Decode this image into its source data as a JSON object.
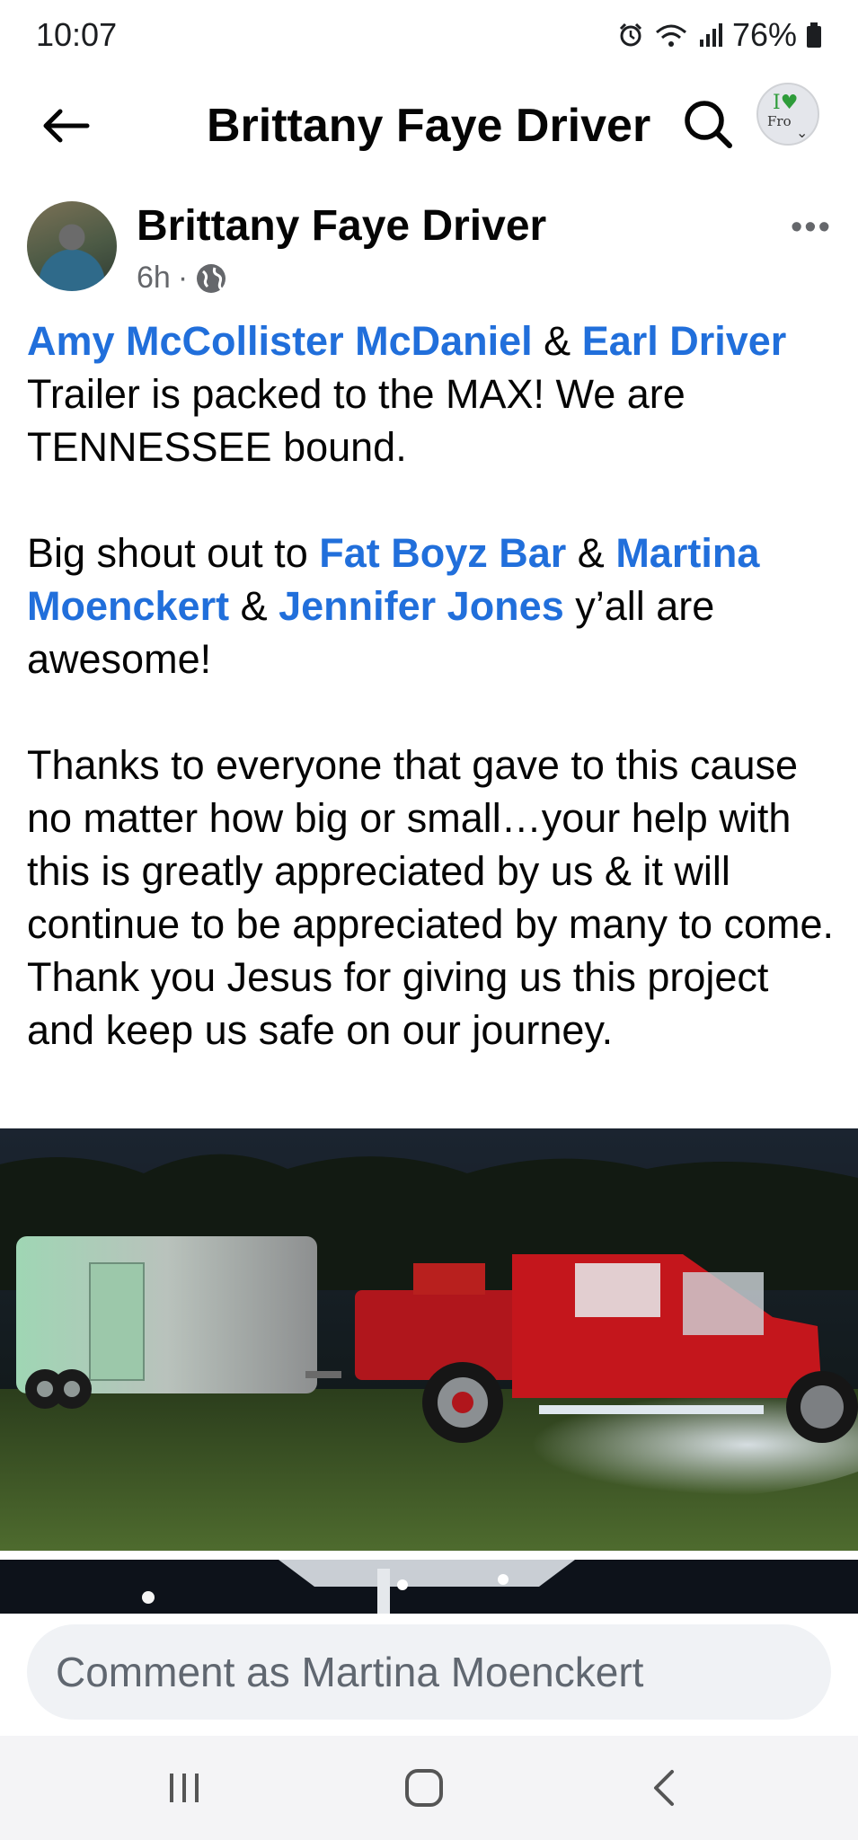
{
  "status_bar": {
    "time": "10:07",
    "battery": "76%"
  },
  "header": {
    "title": "Brittany Faye Driver",
    "profile_switch_text": "Fro"
  },
  "post": {
    "author": "Brittany Faye Driver",
    "time_ago": "6h",
    "separator": "·",
    "more_label": "•••",
    "tags": {
      "amy": "Amy McCollister McDaniel",
      "earl": "Earl Driver",
      "fat_boyz": "Fat Boyz Bar",
      "martina": "Martina Moenckert",
      "jennifer": "Jennifer Jones"
    },
    "text": {
      "amp1": " & ",
      "line1_rest": "Trailer is packed to the MAX! We are TENNESSEE bound.",
      "shout_prefix": "Big shout out to ",
      "amp2": " & ",
      "amp3": " & ",
      "shout_suffix": " y’all are awesome!",
      "thanks": "Thanks to everyone that gave to this cause no matter how big or small…your help with this is greatly appreciated by us & it will continue to be appreciated by many to come.",
      "jesus": "Thank you Jesus for giving us this project and keep us safe on our journey."
    }
  },
  "comment": {
    "placeholder": "Comment as Martina Moenckert"
  },
  "colors": {
    "tag_blue": "#216fdb",
    "secondary_text": "#65676b",
    "comment_bg": "#f0f2f5"
  },
  "icons": [
    "alarm-icon",
    "wifi-icon",
    "signal-icon",
    "battery-icon",
    "back-arrow-icon",
    "search-icon",
    "globe-icon",
    "more-icon",
    "recent-apps-icon",
    "home-icon",
    "nav-back-icon"
  ]
}
